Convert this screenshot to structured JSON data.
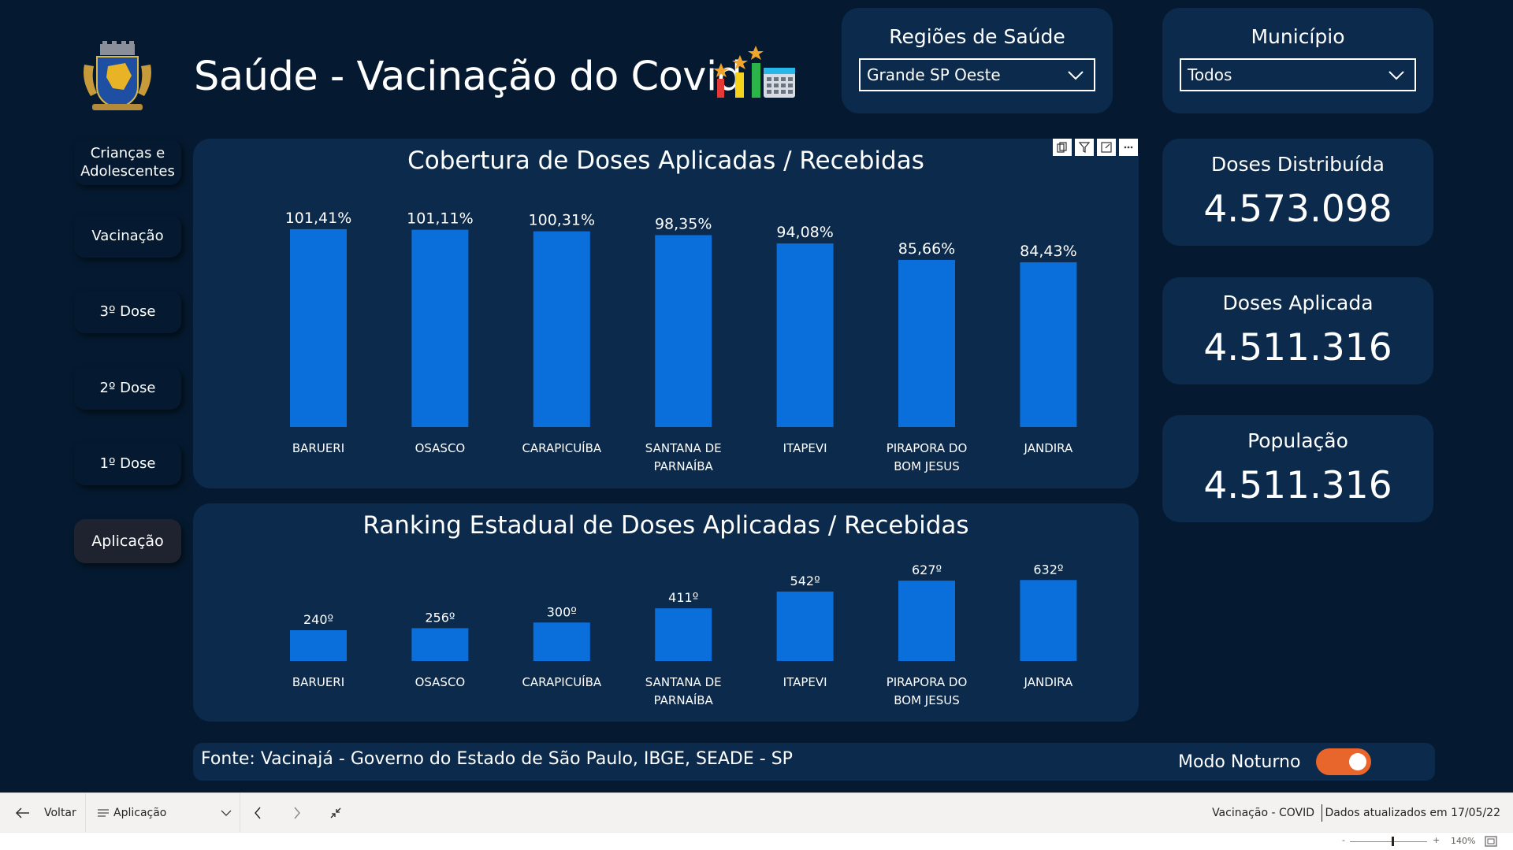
{
  "header": {
    "title": "Saúde - Vacinação do Covid"
  },
  "filters": {
    "region": {
      "label": "Regiões de Saúde",
      "value": "Grande SP Oeste"
    },
    "municipality": {
      "label": "Município",
      "value": "Todos"
    }
  },
  "nav": {
    "items": [
      {
        "label": "Crianças e Adolescentes"
      },
      {
        "label": "Vacinação"
      },
      {
        "label": "3º Dose"
      },
      {
        "label": "2º Dose"
      },
      {
        "label": "1º Dose"
      },
      {
        "label": "Aplicação"
      }
    ],
    "active_index": 5
  },
  "kpis": {
    "distributed": {
      "label": "Doses Distribuída",
      "value": "4.573.098"
    },
    "applied": {
      "label": "Doses Aplicada",
      "value": "4.511.316"
    },
    "population": {
      "label": "População",
      "value": "4.511.316"
    }
  },
  "chart_data": [
    {
      "type": "bar",
      "title": "Cobertura de Doses Aplicadas / Recebidas",
      "categories": [
        "BARUERI",
        "OSASCO",
        "CARAPICUÍBA",
        "SANTANA DE PARNAÍBA",
        "ITAPEVI",
        "PIRAPORA DO BOM JESUS",
        "JANDIRA"
      ],
      "values": [
        101.41,
        101.11,
        100.31,
        98.35,
        94.08,
        85.66,
        84.43
      ],
      "data_labels": [
        "101,41%",
        "101,11%",
        "100,31%",
        "98,35%",
        "94,08%",
        "85,66%",
        "84,43%"
      ],
      "ylim": [
        0,
        105
      ],
      "bar_color": "#0a6edb"
    },
    {
      "type": "bar",
      "title": "Ranking Estadual de Doses Aplicadas / Recebidas",
      "categories": [
        "BARUERI",
        "OSASCO",
        "CARAPICUÍBA",
        "SANTANA DE PARNAÍBA",
        "ITAPEVI",
        "PIRAPORA DO BOM JESUS",
        "JANDIRA"
      ],
      "values": [
        240,
        256,
        300,
        411,
        542,
        627,
        632
      ],
      "data_labels": [
        "240º",
        "256º",
        "300º",
        "411º",
        "542º",
        "627º",
        "632º"
      ],
      "ylim": [
        0,
        640
      ],
      "bar_color": "#0a6edb"
    }
  ],
  "footer": {
    "source": "Fonte: Vacinajá - Governo do Estado de São Paulo, IBGE, SEADE - SP",
    "night_mode_label": "Modo Noturno",
    "night_mode_on": true,
    "toggle_color": "#e8652c"
  },
  "appbar": {
    "back_label": "Voltar",
    "page_label": "Aplicação",
    "report_name": "Vacinação - COVID",
    "updated": "Dados atualizados em 17/05/22",
    "zoom": "140%"
  },
  "colors": {
    "background": "#051a30",
    "panel": "#0b2a4c",
    "bar": "#0a6edb"
  }
}
